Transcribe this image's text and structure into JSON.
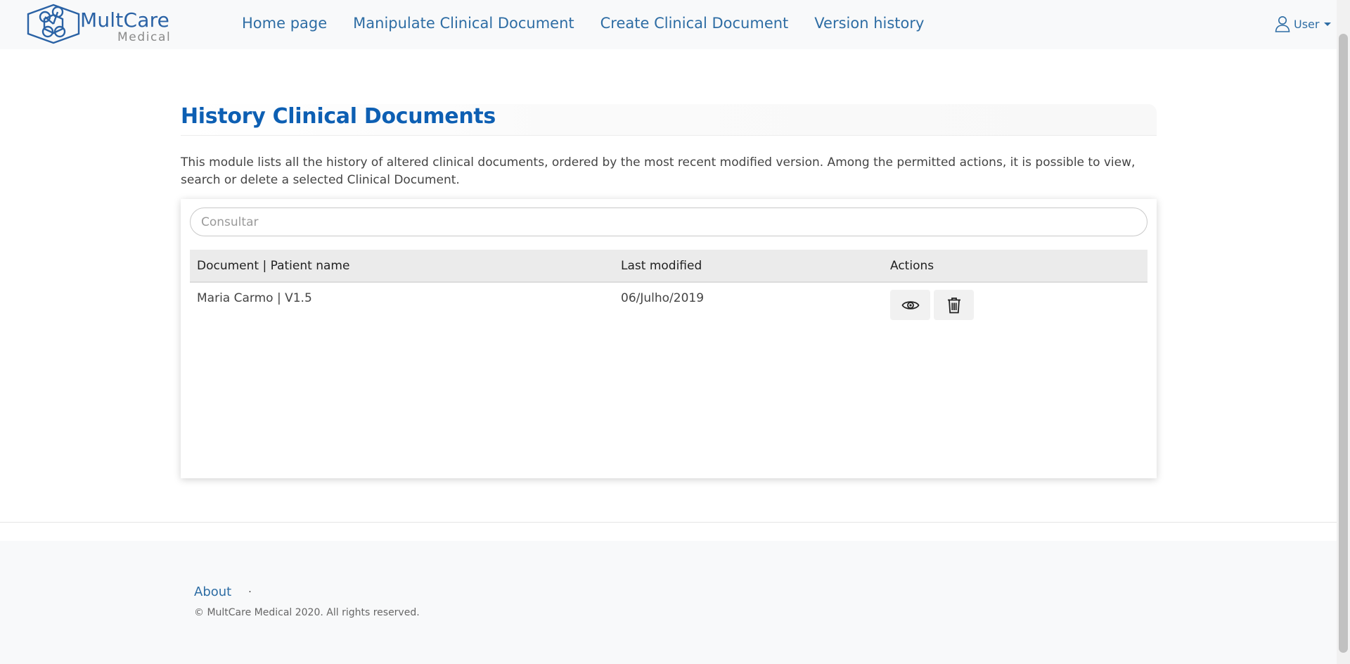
{
  "brand": {
    "name": "MultCare",
    "subtitle": "Medical",
    "logo_icon": "hexagon-molecule-logo"
  },
  "nav": {
    "items": [
      {
        "label": "Home page"
      },
      {
        "label": "Manipulate Clinical Document"
      },
      {
        "label": "Create Clinical Document"
      },
      {
        "label": "Version history"
      }
    ],
    "user_label": "User"
  },
  "main": {
    "title": "History Clinical Documents",
    "description": "This module lists all the history of altered clinical documents, ordered by the most recent modified version. Among the permitted actions, it is possible to view, search or delete a selected Clinical Document.",
    "search_placeholder": "Consultar",
    "table": {
      "headers": [
        "Document | Patient name",
        "Last modified",
        "Actions"
      ],
      "rows": [
        {
          "document": "Maria Carmo | V1.5",
          "last_modified": "06/Julho/2019",
          "actions": [
            "eye-icon",
            "trash-icon"
          ]
        }
      ]
    }
  },
  "footer": {
    "about_label": "About",
    "separator": "·",
    "copyright": "© MultCare Medical 2020. All rights reserved."
  },
  "colors": {
    "brand_blue": "#2a62a5",
    "link_blue": "#2e6da4",
    "title_blue": "#0d5fb3",
    "navbar_bg": "#f8f9fa"
  }
}
